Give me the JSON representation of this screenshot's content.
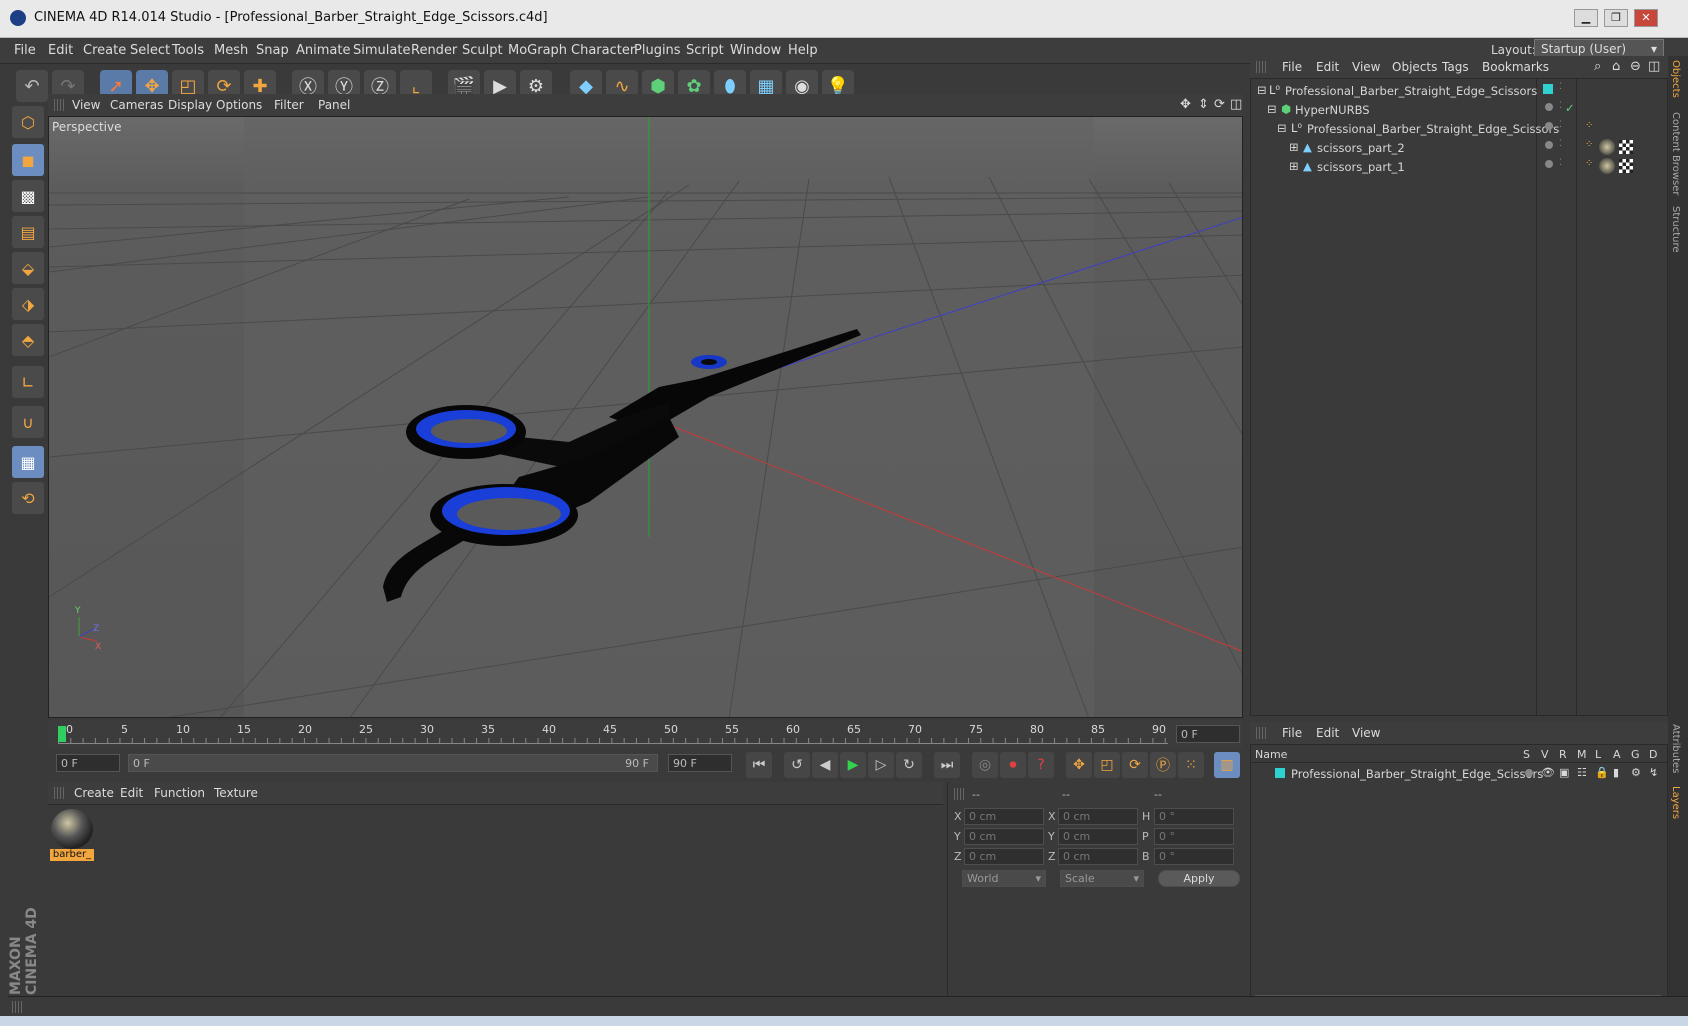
{
  "window": {
    "title": "CINEMA 4D R14.014 Studio - [Professional_Barber_Straight_Edge_Scissors.c4d]"
  },
  "menubar": [
    "File",
    "Edit",
    "Create",
    "Select",
    "Tools",
    "Mesh",
    "Snap",
    "Animate",
    "Simulate",
    "Render",
    "Sculpt",
    "MoGraph",
    "Character",
    "Plugins",
    "Script",
    "Window",
    "Help"
  ],
  "layout": {
    "label": "Layout:",
    "value": "Startup (User)"
  },
  "viewport": {
    "menu": [
      "View",
      "Cameras",
      "Display",
      "Options",
      "Filter",
      "Panel"
    ],
    "label": "Perspective",
    "axis_x": "X",
    "axis_y": "Y",
    "axis_z": "Z"
  },
  "timeline": {
    "ticks": [
      "0",
      "5",
      "10",
      "15",
      "20",
      "25",
      "30",
      "35",
      "40",
      "45",
      "50",
      "55",
      "60",
      "65",
      "70",
      "75",
      "80",
      "85",
      "90"
    ],
    "current_frame": "0 F",
    "start_frame": "0 F",
    "range_start": "0 F",
    "range_end": "90 F",
    "end_frame": "90 F"
  },
  "material_manager": {
    "menu": [
      "Create",
      "Edit",
      "Function",
      "Texture"
    ],
    "material_name": "barber_"
  },
  "coordinates": {
    "headers": [
      "--",
      "--",
      "--"
    ],
    "rows": [
      {
        "l1": "X",
        "v1": "0 cm",
        "l2": "X",
        "v2": "0 cm",
        "l3": "H",
        "v3": "0 °"
      },
      {
        "l1": "Y",
        "v1": "0 cm",
        "l2": "Y",
        "v2": "0 cm",
        "l3": "P",
        "v3": "0 °"
      },
      {
        "l1": "Z",
        "v1": "0 cm",
        "l2": "Z",
        "v2": "0 cm",
        "l3": "B",
        "v3": "0 °"
      }
    ],
    "world": "World",
    "scale": "Scale",
    "apply": "Apply"
  },
  "object_manager": {
    "menu": [
      "File",
      "Edit",
      "View",
      "Objects",
      "Tags",
      "Bookmarks"
    ],
    "items": [
      "Professional_Barber_Straight_Edge_Scissors",
      "HyperNURBS",
      "Professional_Barber_Straight_Edge_Scissors",
      "scissors_part_2",
      "scissors_part_1"
    ]
  },
  "layer_manager": {
    "menu": [
      "File",
      "Edit",
      "View"
    ],
    "name_header": "Name",
    "cols": [
      "S",
      "V",
      "R",
      "M",
      "L",
      "A",
      "G",
      "D"
    ],
    "layer_name": "Professional_Barber_Straight_Edge_Scissors"
  },
  "right_tabs": [
    "Objects",
    "Content Browser",
    "Structure",
    "Attributes",
    "Layers"
  ],
  "branding": "MAXON CINEMA 4D",
  "colors": {
    "accent": "#f2a640",
    "selection": "#6b8dbf",
    "blue_ring": "#1a3fd8"
  }
}
